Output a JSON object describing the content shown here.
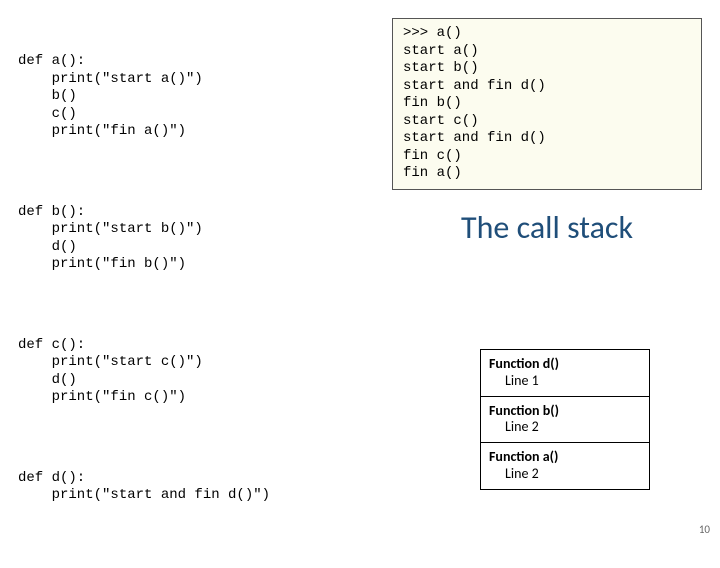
{
  "code": {
    "a": "def a():\n    print(\"start a()\")\n    b()\n    c()\n    print(\"fin a()\")",
    "b": "def b():\n    print(\"start b()\")\n    d()\n    print(\"fin b()\")",
    "c": "def c():\n    print(\"start c()\")\n    d()\n    print(\"fin c()\")",
    "d": "def d():\n    print(\"start and fin d()\")"
  },
  "repl": ">>> a()\nstart a()\nstart b()\nstart and fin d()\nfin b()\nstart c()\nstart and fin d()\nfin c()\nfin a()",
  "title": "The call stack",
  "stack": [
    {
      "fn": "Function d()",
      "ln": "Line 1"
    },
    {
      "fn": "Function b()",
      "ln": "Line 2"
    },
    {
      "fn": "Function a()",
      "ln": "Line 2"
    }
  ],
  "slide_number": "10"
}
